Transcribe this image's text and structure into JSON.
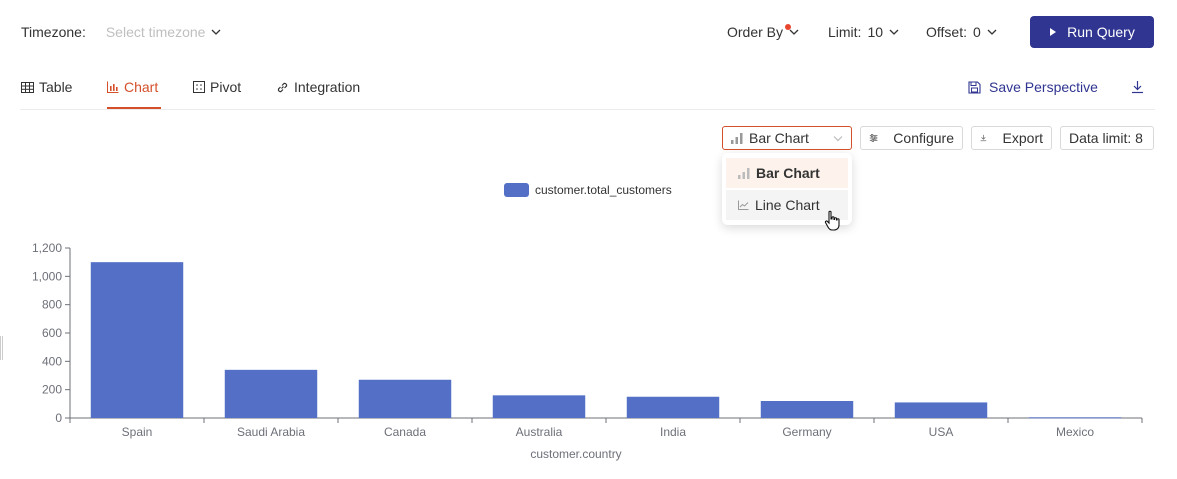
{
  "toolbar": {
    "timezone_label": "Timezone:",
    "timezone_placeholder": "Select timezone",
    "order_by_label": "Order By",
    "limit_label": "Limit:",
    "limit_value": "10",
    "offset_label": "Offset:",
    "offset_value": "0",
    "run_label": "Run Query"
  },
  "tabs": [
    {
      "label": "Table",
      "icon": "table-icon"
    },
    {
      "label": "Chart",
      "icon": "bar-chart-icon",
      "active": true
    },
    {
      "label": "Pivot",
      "icon": "pivot-icon"
    },
    {
      "label": "Integration",
      "icon": "link-icon"
    }
  ],
  "actions": {
    "save_label": "Save Perspective",
    "download_icon": "download-icon"
  },
  "chart_toolbar": {
    "chart_type_value": "Bar Chart",
    "configure_label": "Configure",
    "export_label": "Export",
    "data_limit_label": "Data limit: 8"
  },
  "dropdown": {
    "options": [
      {
        "label": "Bar Chart",
        "selected": true
      },
      {
        "label": "Line Chart",
        "selected": false
      }
    ]
  },
  "colors": {
    "accent": "#d4502a",
    "primary": "#2f3590",
    "series": "#5470c6"
  },
  "chart_data": {
    "type": "bar",
    "categories": [
      "Spain",
      "Saudi Arabia",
      "Canada",
      "Australia",
      "India",
      "Germany",
      "USA",
      "Mexico"
    ],
    "series": [
      {
        "name": "customer.total_customers",
        "values": [
          1100,
          340,
          270,
          160,
          150,
          120,
          110,
          5
        ]
      }
    ],
    "xlabel": "customer.country",
    "ylabel": "",
    "ylim": [
      0,
      1200
    ],
    "yticks": [
      "0",
      "200",
      "400",
      "600",
      "800",
      "1,000",
      "1,200"
    ],
    "legend": "top-center",
    "grid": false
  }
}
